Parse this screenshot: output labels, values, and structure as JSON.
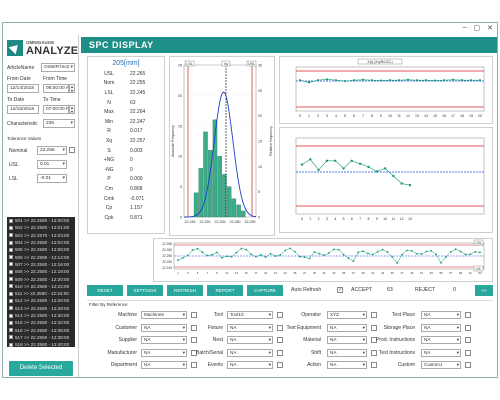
{
  "window": {
    "minimize": "–",
    "maximize": "▢",
    "close": "✕"
  },
  "logo": {
    "small": "OMNIGAUGE",
    "big": "ANALYZE"
  },
  "left": {
    "article_label": "ArticleName",
    "article_value": "OSWR7ec0",
    "from_date_label": "From Date",
    "from_date": "12/14/2018",
    "from_time_label": "From Time",
    "from_time": "08:00:00 AM",
    "to_date_label": "To Date",
    "to_date": "12/15/2018",
    "to_time_label": "To Time",
    "to_time": "07:00:00 PM",
    "characteristic_label": "Characteristic",
    "characteristic_value": "235",
    "tolerance_label": "Tolerance Values",
    "nominal_label": "Nominal",
    "nominal_value": "22.255",
    "usl_label": "USL",
    "usl_value": "0.01",
    "lsl_label": "LSL",
    "lsl_value": "-0.01",
    "list_items": [
      "501 >> 22.2580 - 12:00:00",
      "502 >> 22.2580 - 12:01:00",
      "503 >> 22.2570 - 12:03:00",
      "504 >> 22.2580 - 12:04:00",
      "505 >> 22.2580 - 12:06:00",
      "506 >> 22.2580 - 12:14:00",
      "507 >> 22.2580 - 12:16:00",
      "508 >> 22.2580 - 12:19:00",
      "509 >> 22.2580 - 12:20:00",
      "510 >> 22.2580 - 12:22:00",
      "511 >> 22.2580 - 12:24:00",
      "512 >> 22.2580 - 12:26:00",
      "513 >> 22.2580 - 12:28:00",
      "514 >> 22.2580 - 12:30:00",
      "515 >> 22.2580 - 12:32:00",
      "516 >> 22.2580 - 12:36:00",
      "517 >> 22.2560 - 12:38:00",
      "518 >> 22.2580 - 12:40:00"
    ],
    "delete_button": "Delete Selected"
  },
  "main": {
    "title": "SPC DISPLAY",
    "stats_title": "205[mm]",
    "stats": [
      {
        "k": "USL",
        "v": "22.265"
      },
      {
        "k": "Nom",
        "v": "22.255"
      },
      {
        "k": "LSL",
        "v": "22.245"
      },
      {
        "k": "N",
        "v": "63"
      },
      {
        "k": "Max",
        "v": "22.264"
      },
      {
        "k": "Min",
        "v": "22.247"
      },
      {
        "k": "R",
        "v": "0.017"
      },
      {
        "k": "Xq",
        "v": "22.257"
      },
      {
        "k": "S",
        "v": "0.003"
      },
      {
        "k": "+NG",
        "v": "0"
      },
      {
        "k": "-NG",
        "v": "0"
      },
      {
        "k": "P",
        "v": "0.000"
      },
      {
        "k": "Cm",
        "v": "0.868"
      },
      {
        "k": "Cmk",
        "v": "-0.071"
      },
      {
        "k": "Cp",
        "v": "1.157"
      },
      {
        "k": "Cpk",
        "v": "0.871"
      }
    ]
  },
  "toolbar": {
    "reset": "RESET",
    "settings": "SETTINGS",
    "refresh": "REFRESH",
    "report": "REPORT",
    "capture": "CAPTURE",
    "auto_refresh": "Auto Refresh",
    "accept_label": "ACCEPT",
    "accept_value": "63",
    "reject_label": "REJECT",
    "reject_value": "0",
    "next": ">>"
  },
  "filter": {
    "header": "Filter By Reference",
    "col1": [
      {
        "label": "Machine",
        "value": "Machine5"
      },
      {
        "label": "Customer",
        "value": "NA"
      },
      {
        "label": "Supplier",
        "value": "NA"
      },
      {
        "label": "Manufacturer",
        "value": "NA"
      },
      {
        "label": "Department",
        "value": "NA"
      }
    ],
    "col2": [
      {
        "label": "Tool",
        "value": "Tool10"
      },
      {
        "label": "Fixture",
        "value": "NA"
      },
      {
        "label": "Nest",
        "value": "NA"
      },
      {
        "label": "Batch/Serial",
        "value": "NA"
      },
      {
        "label": "Events",
        "value": "NA"
      }
    ],
    "col3": [
      {
        "label": "Operator",
        "value": "XYZ"
      },
      {
        "label": "Test Equipment",
        "value": "NA"
      },
      {
        "label": "Material",
        "value": "NA"
      },
      {
        "label": "Shift",
        "value": "NA"
      },
      {
        "label": "Action",
        "value": "NA"
      }
    ],
    "col4": [
      {
        "label": "Test Place",
        "value": "NA"
      },
      {
        "label": "Storage Place",
        "value": "NA"
      },
      {
        "label": "Prod. Instructions",
        "value": "NA"
      },
      {
        "label": "Test Instructions",
        "value": "NA"
      },
      {
        "label": "Custom",
        "value": "Custom1"
      }
    ]
  },
  "charts": {
    "hist_legend_lsl": "LSL",
    "hist_legend_xq": "Xq",
    "hist_legend_usl": "USL",
    "hist_ylabel": "Absolute Frequency",
    "hist_ylabel2": "Relative frequency",
    "hist_xticks": [
      "22.245",
      "22.250",
      "22.255",
      "22.260",
      "22.265"
    ],
    "hist_yticks": [
      "0",
      "5",
      "10",
      "15",
      "20",
      "25"
    ],
    "hist_y2ticks": [
      "0",
      "5",
      "10",
      "15",
      "20",
      "25",
      "30"
    ],
    "xbar_title": "X(t) (Xq/R/UCL)",
    "xbar_xticks": [
      "0",
      "1",
      "2",
      "3",
      "4",
      "5",
      "6",
      "7",
      "8",
      "9",
      "10",
      "11",
      "12",
      "13",
      "14",
      "15",
      "16",
      "17",
      "18",
      "19",
      "20"
    ],
    "range_xticks": [
      "0",
      "1",
      "2",
      "3",
      "4",
      "5",
      "6",
      "7",
      "8",
      "9",
      "10",
      "11",
      "12",
      "13"
    ],
    "run_yticks": [
      "22.265",
      "22.260",
      "22.255",
      "22.250",
      "22.245"
    ],
    "colors": {
      "accent": "#1d8f86",
      "bar": "#3cab8a",
      "limit": "#d92020",
      "center": "#1a4fd6",
      "series": "#159a7f"
    }
  }
}
